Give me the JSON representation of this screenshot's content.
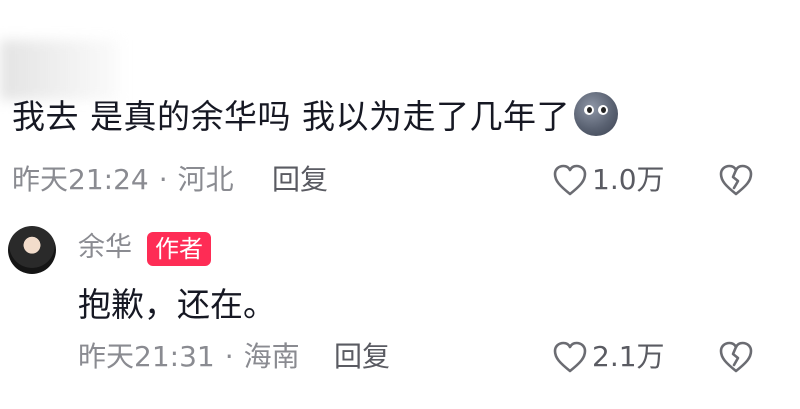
{
  "comment": {
    "text": "我去 是真的余华吗 我以为走了几年了",
    "emoji": "moon-face-emoji",
    "meta": {
      "time": "昨天21:24",
      "separator": "·",
      "location": "河北"
    },
    "reply_label": "回复",
    "likes": "1.0万"
  },
  "reply": {
    "author_name": "余华",
    "author_badge": "作者",
    "text": "抱歉，还在。",
    "meta": {
      "time": "昨天21:31",
      "separator": "·",
      "location": "海南"
    },
    "reply_label": "回复",
    "likes": "2.1万"
  },
  "icons": {
    "like": "heart-outline-icon",
    "dislike": "broken-heart-icon"
  },
  "colors": {
    "text_primary": "#161823",
    "text_secondary": "#8a8b91",
    "author_badge_bg": "#fe2c55"
  }
}
